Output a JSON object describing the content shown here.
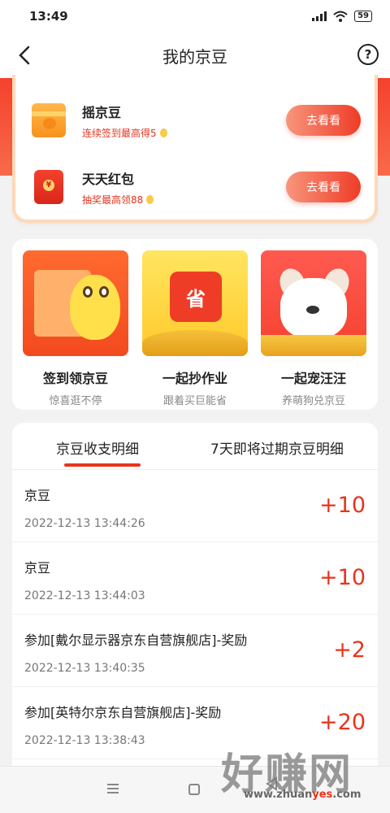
{
  "status_bar": {
    "time": "13:49",
    "battery": "59"
  },
  "header": {
    "title": "我的京豆",
    "help": "?"
  },
  "tasks": [
    {
      "title": "摇京豆",
      "subtitle": "连续签到最高得5",
      "button": "去看看",
      "icon": "gift-icon"
    },
    {
      "title": "天天红包",
      "subtitle": "抽奖最高领88",
      "button": "去看看",
      "icon": "red-envelope-icon"
    }
  ],
  "features": [
    {
      "title": "签到领京豆",
      "subtitle": "惊喜逛不停",
      "image_text": ""
    },
    {
      "title": "一起抄作业",
      "subtitle": "跟着买巨能省",
      "image_text": "省"
    },
    {
      "title": "一起宠汪汪",
      "subtitle": "养萌狗兑京豆",
      "image_text": ""
    }
  ],
  "tabs": [
    "京豆收支明细",
    "7天即将过期京豆明细"
  ],
  "records": [
    {
      "title": "京豆",
      "time": "2022-12-13 13:44:26",
      "amount": "+10"
    },
    {
      "title": "京豆",
      "time": "2022-12-13 13:44:03",
      "amount": "+10"
    },
    {
      "title": "参加[戴尔显示器京东自营旗舰店]-奖励",
      "time": "2022-12-13 13:40:35",
      "amount": "+2"
    },
    {
      "title": "参加[英特尔京东自营旗舰店]-奖励",
      "time": "2022-12-13 13:38:43",
      "amount": "+20"
    }
  ],
  "watermark": {
    "text": "好赚网",
    "url_prefix": "www.zhuan",
    "url_accent": "yes",
    "url_suffix": ".com"
  },
  "colors": {
    "accent": "#e8341c",
    "background": "#f2f2f2"
  }
}
